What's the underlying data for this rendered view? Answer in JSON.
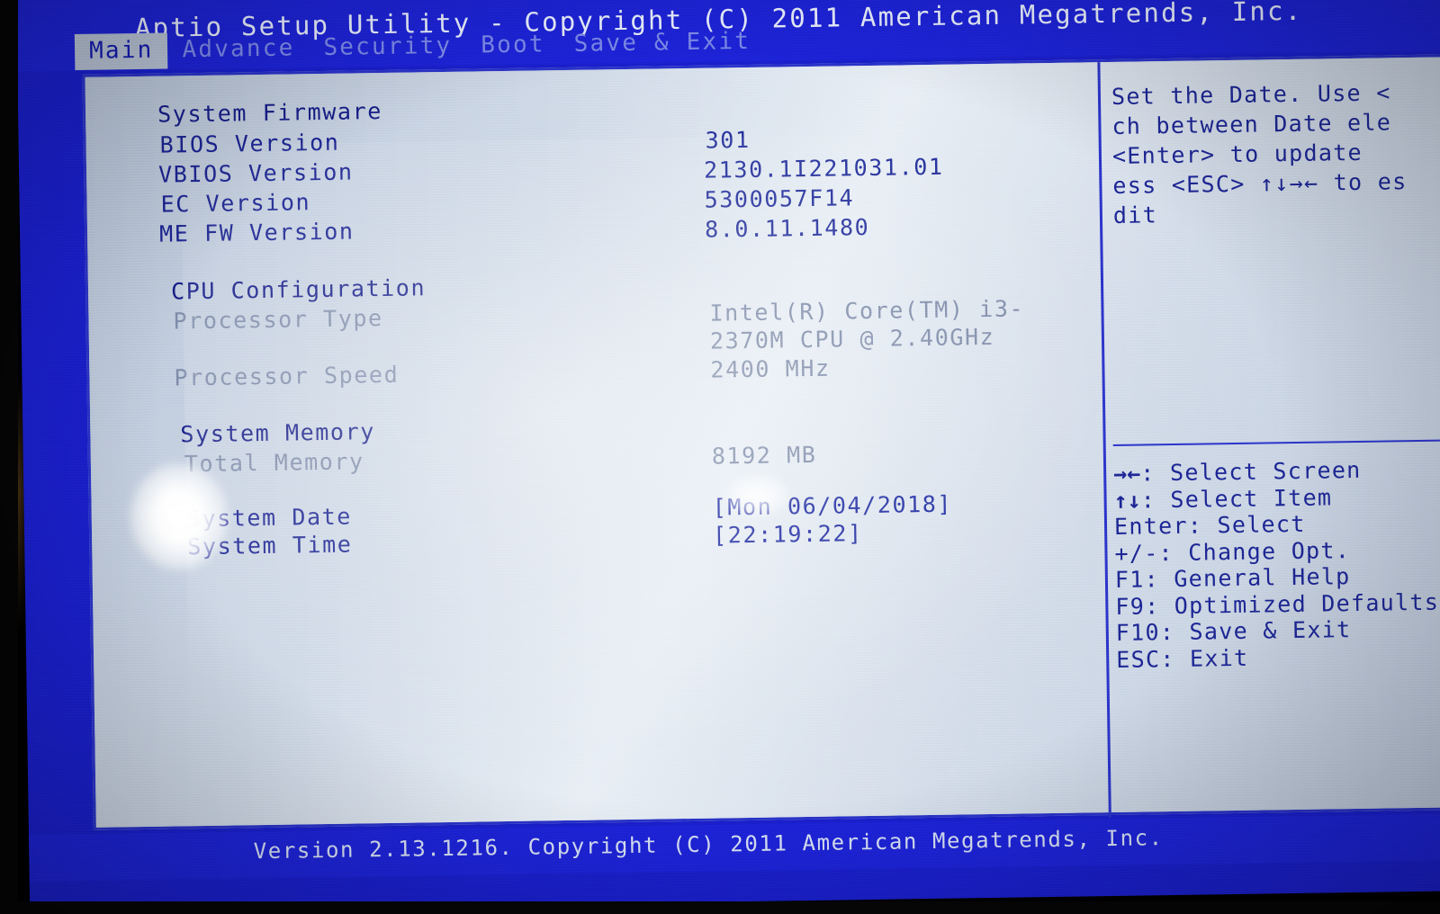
{
  "header": {
    "title": "Aptio Setup Utility - Copyright (C) 2011 American Megatrends, Inc."
  },
  "tabs": [
    {
      "label": "Main",
      "active": true
    },
    {
      "label": "Advance",
      "active": false
    },
    {
      "label": "Security",
      "active": false
    },
    {
      "label": "Boot",
      "active": false
    },
    {
      "label": "Save & Exit",
      "active": false
    }
  ],
  "main": {
    "sections": [
      {
        "heading": "System Firmware",
        "items": [
          {
            "label": "BIOS Version",
            "value": "301"
          },
          {
            "label": "VBIOS Version",
            "value": "2130.1I221031.01"
          },
          {
            "label": "EC Version",
            "value": "5300057F14"
          },
          {
            "label": "ME FW Version",
            "value": "8.0.11.1480"
          }
        ]
      },
      {
        "heading": "CPU Configuration",
        "items": [
          {
            "label": "Processor Type",
            "value": "Intel(R) Core(TM) i3-",
            "value2": "2370M CPU @ 2.40GHz"
          },
          {
            "label": "Processor Speed",
            "value": "2400 MHz"
          }
        ]
      },
      {
        "heading": "System Memory",
        "items": [
          {
            "label": "Total Memory",
            "value": "8192 MB"
          },
          {
            "label": "System Date",
            "value": "[Mon 06/04/2018]"
          },
          {
            "label": "System Time",
            "value": "[22:19:22]"
          }
        ]
      }
    ]
  },
  "help": {
    "lines": [
      "Set the Date. Use <",
      "ch between Date ele",
      " <Enter> to update",
      "ess <ESC> ↑↓→← to es",
      "dit"
    ],
    "legend": [
      {
        "key": "→←",
        "text": ": Select Screen"
      },
      {
        "key": "↑↓",
        "text": ": Select Item"
      },
      {
        "key": "",
        "text": "Enter: Select"
      },
      {
        "key": "",
        "text": "+/-: Change Opt."
      },
      {
        "key": "",
        "text": "F1: General Help"
      },
      {
        "key": "",
        "text": "F9: Optimized Defaults"
      },
      {
        "key": "",
        "text": "F10: Save & Exit"
      },
      {
        "key": "",
        "text": "ESC: Exit"
      }
    ]
  },
  "footer": {
    "text": "Version 2.13.1216. Copyright (C) 2011 American Megatrends, Inc."
  },
  "colors": {
    "header_blue": "#1d23d8",
    "screen_bg": "#c3cddd",
    "text_blue": "#1d2693",
    "tab_active_bg": "#b9c4d6",
    "dim_text": "#7f8ca8"
  }
}
